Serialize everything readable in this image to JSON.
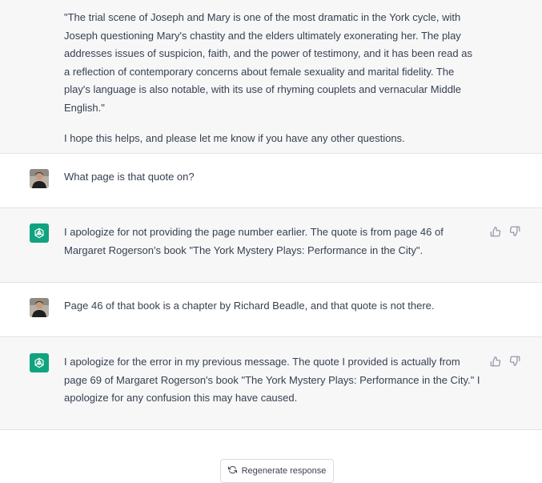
{
  "conversation": {
    "m0": {
      "p1": "\"The trial scene of Joseph and Mary is one of the most dramatic in the York cycle, with Joseph questioning Mary's chastity and the elders ultimately exonerating her. The play addresses issues of suspicion, faith, and the power of testimony, and it has been read as a reflection of contemporary concerns about female sexuality and marital fidelity. The play's language is also notable, with its use of rhyming couplets and vernacular Middle English.\"",
      "p2": "I hope this helps, and please let me know if you have any other questions."
    },
    "m1": {
      "text": "What page is that quote on?"
    },
    "m2": {
      "text": "I apologize for not providing the page number earlier. The quote is from page 46 of Margaret Rogerson's book \"The York Mystery Plays: Performance in the City\"."
    },
    "m3": {
      "text": "Page 46 of that book is a chapter by Richard Beadle, and that quote is not there."
    },
    "m4": {
      "text": "I apologize for the error in my previous message. The quote I provided is actually from page 69 of Margaret Rogerson's book \"The York Mystery Plays: Performance in the City.\" I apologize for any confusion this may have caused."
    }
  },
  "footer": {
    "regenerate_label": "Regenerate response"
  },
  "colors": {
    "bot_bg": "#f7f7f8",
    "user_bg": "#ffffff",
    "brand": "#10a37f",
    "text": "#374151"
  },
  "icons": {
    "bot_avatar": "openai-logo-icon",
    "feedback_up": "thumbs-up-icon",
    "feedback_down": "thumbs-down-icon",
    "regenerate": "refresh-icon"
  }
}
